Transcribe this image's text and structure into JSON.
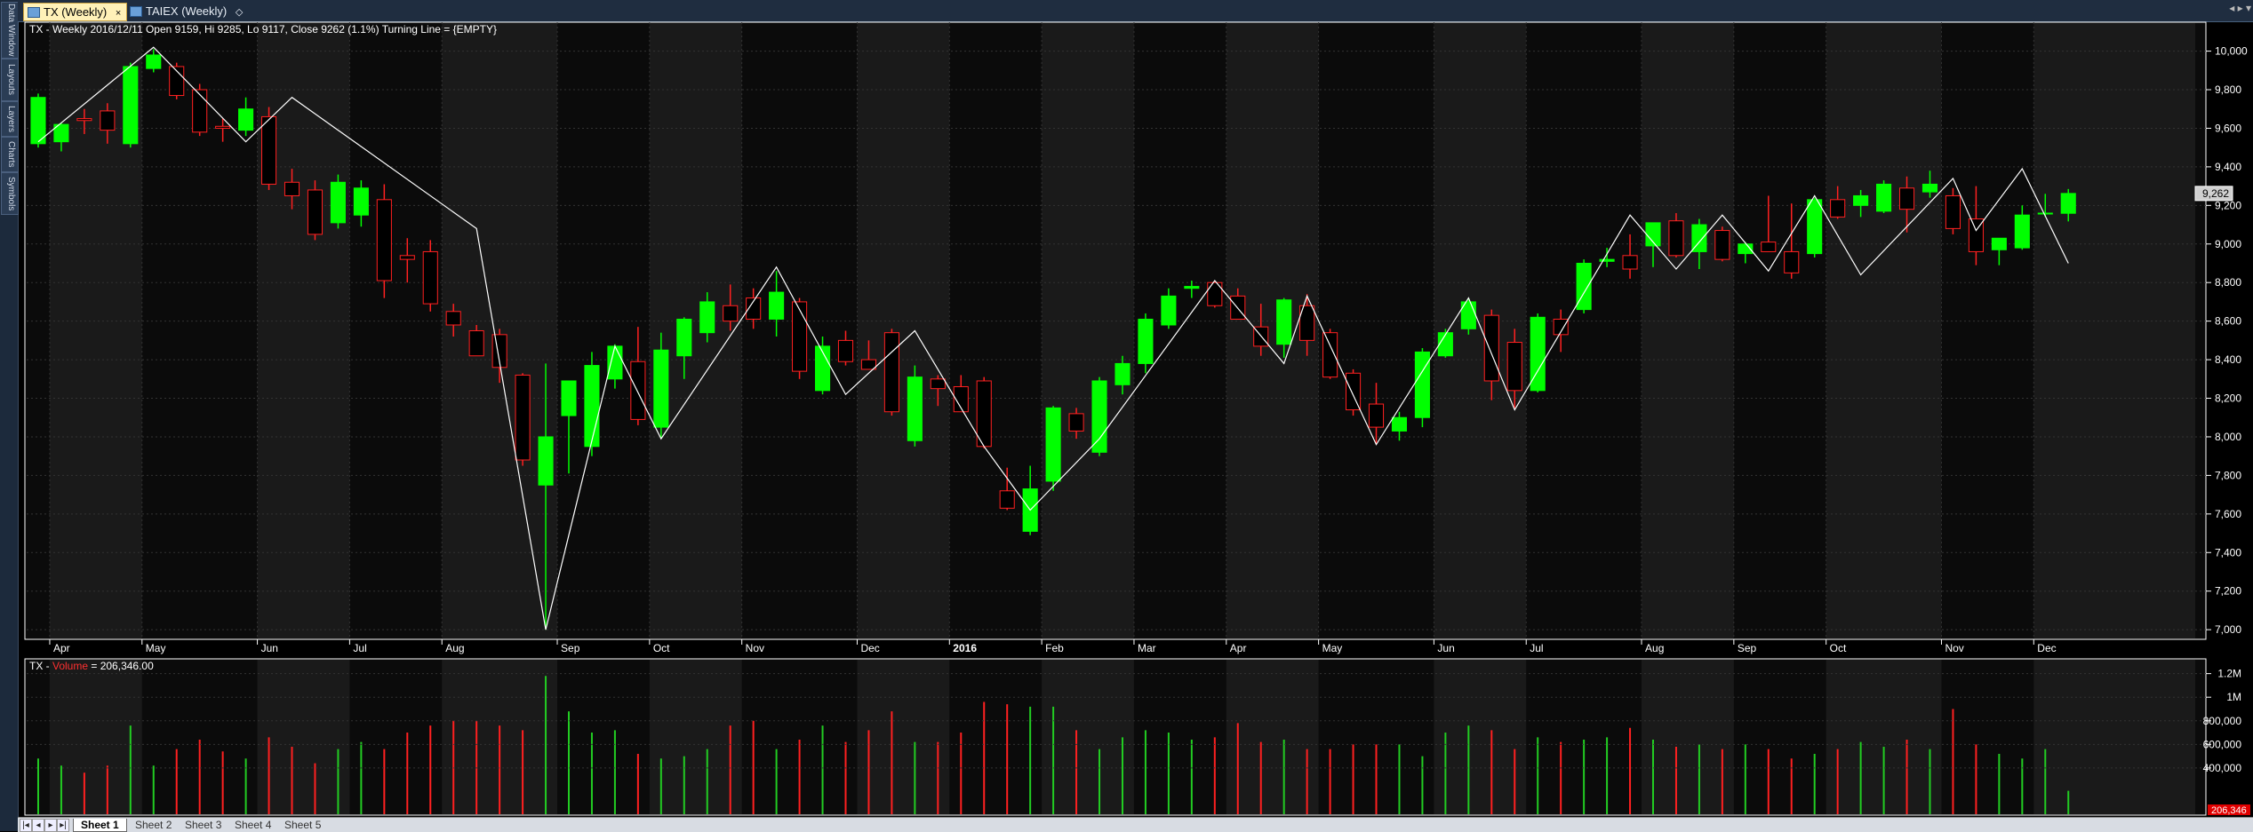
{
  "tabs": [
    {
      "label": "TX (Weekly)",
      "close": "×",
      "active": true
    },
    {
      "label": "TAIEX (Weekly)",
      "close": "◇",
      "active": false
    }
  ],
  "side_tabs": [
    "Data Window",
    "Layouts",
    "Layers",
    "Charts",
    "Symbols"
  ],
  "window_controls": "◂ ▸ ▾",
  "sheets": [
    "Sheet 1",
    "Sheet 2",
    "Sheet 3",
    "Sheet 4",
    "Sheet 5"
  ],
  "sheet_nav": [
    "|◂",
    "◂",
    "▸",
    "▸|"
  ],
  "price_title": "TX - Weekly 2016/12/11 Open 9159, Hi 9285, Lo 9117, Close 9262 (1.1%) Turning Line = {EMPTY}",
  "volume_title_prefix": "TX - ",
  "volume_title_name": "Volume",
  "volume_title_value": " = 206,346.00",
  "last_price_label": "9,262",
  "last_volume_label": "206,346",
  "colors": {
    "up": "#00ff00",
    "down_body": "#000000",
    "down_border": "#ff2020",
    "volume_up": "#22cc22",
    "volume_down": "#ff2020",
    "line": "#ffffff",
    "bg": "#0b0b0b",
    "band": "#1a1a1a",
    "axis_text": "#ffffff"
  },
  "chart_data": {
    "type": "candlestick",
    "y_axis": {
      "min": 6950,
      "max": 10150,
      "ticks": [
        7000,
        7200,
        7400,
        7600,
        7800,
        8000,
        8200,
        8400,
        8600,
        8800,
        9000,
        9200,
        9400,
        9600,
        9800,
        10000
      ],
      "tick_labels": [
        "7,000",
        "7,200",
        "7,400",
        "7,600",
        "7,800",
        "8,000",
        "8,200",
        "8,400",
        "8,600",
        "8,800",
        "9,000",
        "9,200",
        "9,400",
        "9,600",
        "9,800",
        "10,000"
      ]
    },
    "x_axis_labels": [
      "Apr",
      "May",
      "Jun",
      "Jul",
      "Aug",
      "Sep",
      "Oct",
      "Nov",
      "Dec",
      "2016",
      "Feb",
      "Mar",
      "Apr",
      "May",
      "Jun",
      "Jul",
      "Aug",
      "Sep",
      "Oct",
      "Nov",
      "Dec"
    ],
    "x_axis_label_weeks": [
      1,
      5,
      10,
      14,
      18,
      23,
      27,
      31,
      36,
      40,
      44,
      48,
      52,
      56,
      61,
      65,
      70,
      74,
      78,
      83,
      87
    ],
    "candles": [
      {
        "o": 9520,
        "h": 9780,
        "l": 9500,
        "c": 9760
      },
      {
        "o": 9530,
        "h": 9630,
        "l": 9480,
        "c": 9620
      },
      {
        "o": 9650,
        "h": 9700,
        "l": 9570,
        "c": 9640
      },
      {
        "o": 9690,
        "h": 9730,
        "l": 9520,
        "c": 9590
      },
      {
        "o": 9520,
        "h": 9940,
        "l": 9500,
        "c": 9920
      },
      {
        "o": 9910,
        "h": 10010,
        "l": 9890,
        "c": 9980
      },
      {
        "o": 9920,
        "h": 9940,
        "l": 9750,
        "c": 9770
      },
      {
        "o": 9800,
        "h": 9830,
        "l": 9560,
        "c": 9580
      },
      {
        "o": 9610,
        "h": 9650,
        "l": 9530,
        "c": 9600
      },
      {
        "o": 9590,
        "h": 9760,
        "l": 9560,
        "c": 9700
      },
      {
        "o": 9660,
        "h": 9710,
        "l": 9280,
        "c": 9310
      },
      {
        "o": 9320,
        "h": 9390,
        "l": 9180,
        "c": 9250
      },
      {
        "o": 9280,
        "h": 9330,
        "l": 9020,
        "c": 9050
      },
      {
        "o": 9110,
        "h": 9360,
        "l": 9080,
        "c": 9320
      },
      {
        "o": 9150,
        "h": 9330,
        "l": 9090,
        "c": 9290
      },
      {
        "o": 9230,
        "h": 9310,
        "l": 8720,
        "c": 8810
      },
      {
        "o": 8940,
        "h": 9030,
        "l": 8800,
        "c": 8920
      },
      {
        "o": 8960,
        "h": 9020,
        "l": 8650,
        "c": 8690
      },
      {
        "o": 8650,
        "h": 8690,
        "l": 8520,
        "c": 8580
      },
      {
        "o": 8550,
        "h": 8580,
        "l": 8430,
        "c": 8420
      },
      {
        "o": 8530,
        "h": 8560,
        "l": 8280,
        "c": 8360
      },
      {
        "o": 8320,
        "h": 8330,
        "l": 7850,
        "c": 7880
      },
      {
        "o": 7750,
        "h": 8380,
        "l": 7000,
        "c": 8000
      },
      {
        "o": 8110,
        "h": 8280,
        "l": 7810,
        "c": 8290
      },
      {
        "o": 7950,
        "h": 8440,
        "l": 7900,
        "c": 8370
      },
      {
        "o": 8300,
        "h": 8480,
        "l": 8250,
        "c": 8470
      },
      {
        "o": 8390,
        "h": 8570,
        "l": 8060,
        "c": 8090
      },
      {
        "o": 8050,
        "h": 8540,
        "l": 7990,
        "c": 8450
      },
      {
        "o": 8420,
        "h": 8620,
        "l": 8300,
        "c": 8610
      },
      {
        "o": 8540,
        "h": 8750,
        "l": 8490,
        "c": 8700
      },
      {
        "o": 8680,
        "h": 8790,
        "l": 8550,
        "c": 8600
      },
      {
        "o": 8720,
        "h": 8770,
        "l": 8560,
        "c": 8610
      },
      {
        "o": 8610,
        "h": 8860,
        "l": 8520,
        "c": 8750
      },
      {
        "o": 8700,
        "h": 8720,
        "l": 8300,
        "c": 8340
      },
      {
        "o": 8240,
        "h": 8520,
        "l": 8220,
        "c": 8470
      },
      {
        "o": 8500,
        "h": 8550,
        "l": 8370,
        "c": 8390
      },
      {
        "o": 8400,
        "h": 8500,
        "l": 8360,
        "c": 8350
      },
      {
        "o": 8540,
        "h": 8560,
        "l": 8110,
        "c": 8130
      },
      {
        "o": 7980,
        "h": 8370,
        "l": 7950,
        "c": 8310
      },
      {
        "o": 8300,
        "h": 8320,
        "l": 8160,
        "c": 8250
      },
      {
        "o": 8260,
        "h": 8320,
        "l": 8130,
        "c": 8130
      },
      {
        "o": 8290,
        "h": 8310,
        "l": 7940,
        "c": 7950
      },
      {
        "o": 7720,
        "h": 7840,
        "l": 7620,
        "c": 7630
      },
      {
        "o": 7510,
        "h": 7850,
        "l": 7490,
        "c": 7730
      },
      {
        "o": 7770,
        "h": 8160,
        "l": 7720,
        "c": 8150
      },
      {
        "o": 8120,
        "h": 8150,
        "l": 7990,
        "c": 8030
      },
      {
        "o": 7920,
        "h": 8310,
        "l": 7900,
        "c": 8290
      },
      {
        "o": 8270,
        "h": 8420,
        "l": 8220,
        "c": 8380
      },
      {
        "o": 8380,
        "h": 8640,
        "l": 8330,
        "c": 8610
      },
      {
        "o": 8580,
        "h": 8770,
        "l": 8560,
        "c": 8730
      },
      {
        "o": 8770,
        "h": 8810,
        "l": 8720,
        "c": 8780
      },
      {
        "o": 8800,
        "h": 8810,
        "l": 8670,
        "c": 8680
      },
      {
        "o": 8730,
        "h": 8770,
        "l": 8630,
        "c": 8610
      },
      {
        "o": 8570,
        "h": 8690,
        "l": 8420,
        "c": 8470
      },
      {
        "o": 8480,
        "h": 8720,
        "l": 8410,
        "c": 8710
      },
      {
        "o": 8680,
        "h": 8740,
        "l": 8420,
        "c": 8500
      },
      {
        "o": 8540,
        "h": 8560,
        "l": 8300,
        "c": 8310
      },
      {
        "o": 8330,
        "h": 8350,
        "l": 8110,
        "c": 8140
      },
      {
        "o": 8170,
        "h": 8280,
        "l": 7960,
        "c": 8050
      },
      {
        "o": 8030,
        "h": 8130,
        "l": 7980,
        "c": 8100
      },
      {
        "o": 8100,
        "h": 8460,
        "l": 8050,
        "c": 8440
      },
      {
        "o": 8420,
        "h": 8560,
        "l": 8410,
        "c": 8540
      },
      {
        "o": 8560,
        "h": 8720,
        "l": 8530,
        "c": 8700
      },
      {
        "o": 8630,
        "h": 8660,
        "l": 8190,
        "c": 8290
      },
      {
        "o": 8490,
        "h": 8560,
        "l": 8150,
        "c": 8240
      },
      {
        "o": 8240,
        "h": 8640,
        "l": 8230,
        "c": 8620
      },
      {
        "o": 8610,
        "h": 8660,
        "l": 8440,
        "c": 8530
      },
      {
        "o": 8660,
        "h": 8920,
        "l": 8640,
        "c": 8900
      },
      {
        "o": 8910,
        "h": 8980,
        "l": 8880,
        "c": 8920
      },
      {
        "o": 8940,
        "h": 9050,
        "l": 8820,
        "c": 8870
      },
      {
        "o": 8990,
        "h": 9110,
        "l": 8880,
        "c": 9110
      },
      {
        "o": 9120,
        "h": 9160,
        "l": 8930,
        "c": 8940
      },
      {
        "o": 8960,
        "h": 9130,
        "l": 8870,
        "c": 9100
      },
      {
        "o": 9070,
        "h": 9090,
        "l": 8910,
        "c": 8920
      },
      {
        "o": 8950,
        "h": 9010,
        "l": 8900,
        "c": 9000
      },
      {
        "o": 9010,
        "h": 9250,
        "l": 8960,
        "c": 8960
      },
      {
        "o": 8960,
        "h": 9210,
        "l": 8820,
        "c": 8850
      },
      {
        "o": 8950,
        "h": 9240,
        "l": 8930,
        "c": 9230
      },
      {
        "o": 9230,
        "h": 9300,
        "l": 9130,
        "c": 9140
      },
      {
        "o": 9200,
        "h": 9280,
        "l": 9140,
        "c": 9250
      },
      {
        "o": 9170,
        "h": 9330,
        "l": 9160,
        "c": 9310
      },
      {
        "o": 9290,
        "h": 9350,
        "l": 9060,
        "c": 9180
      },
      {
        "o": 9270,
        "h": 9380,
        "l": 9240,
        "c": 9310
      },
      {
        "o": 9250,
        "h": 9290,
        "l": 9050,
        "c": 9080
      },
      {
        "o": 9130,
        "h": 9300,
        "l": 8890,
        "c": 8960
      },
      {
        "o": 8970,
        "h": 9030,
        "l": 8890,
        "c": 9030
      },
      {
        "o": 8980,
        "h": 9200,
        "l": 8970,
        "c": 9150
      },
      {
        "o": 9160,
        "h": 9260,
        "l": 9140,
        "c": 9160
      },
      {
        "o": 9159,
        "h": 9285,
        "l": 9117,
        "c": 9262
      }
    ],
    "turning_line": [
      [
        0,
        9530
      ],
      [
        5,
        10020
      ],
      [
        9,
        9530
      ],
      [
        11,
        9760
      ],
      [
        19,
        9080
      ],
      [
        22,
        7000
      ],
      [
        25,
        8470
      ],
      [
        27,
        7990
      ],
      [
        32,
        8880
      ],
      [
        35,
        8220
      ],
      [
        38,
        8550
      ],
      [
        41,
        7950
      ],
      [
        43,
        7620
      ],
      [
        46,
        7990
      ],
      [
        51,
        8810
      ],
      [
        54,
        8380
      ],
      [
        55,
        8730
      ],
      [
        58,
        7960
      ],
      [
        62,
        8720
      ],
      [
        64,
        8140
      ],
      [
        69,
        9150
      ],
      [
        71,
        8870
      ],
      [
        73,
        9150
      ],
      [
        75,
        8860
      ],
      [
        77,
        9250
      ],
      [
        79,
        8840
      ],
      [
        83,
        9340
      ],
      [
        84,
        9070
      ],
      [
        86,
        9390
      ],
      [
        88,
        8900
      ]
    ],
    "volume_axis": {
      "max": 1250000,
      "ticks": [
        400000,
        600000,
        800000,
        1000000,
        1200000
      ],
      "tick_labels": [
        "400,000",
        "600,000",
        "800,000",
        "1M",
        "1.2M"
      ]
    },
    "volumes": [
      480000,
      420000,
      360000,
      420000,
      760000,
      420000,
      560000,
      640000,
      540000,
      480000,
      660000,
      580000,
      440000,
      560000,
      620000,
      560000,
      700000,
      760000,
      800000,
      800000,
      760000,
      720000,
      1180000,
      880000,
      700000,
      720000,
      520000,
      480000,
      500000,
      560000,
      760000,
      800000,
      560000,
      640000,
      760000,
      620000,
      720000,
      880000,
      620000,
      620000,
      700000,
      960000,
      940000,
      920000,
      920000,
      720000,
      560000,
      660000,
      720000,
      700000,
      640000,
      660000,
      780000,
      620000,
      640000,
      560000,
      560000,
      600000,
      600000,
      600000,
      500000,
      700000,
      760000,
      720000,
      560000,
      660000,
      620000,
      640000,
      660000,
      740000,
      640000,
      580000,
      600000,
      560000,
      600000,
      560000,
      480000,
      520000,
      560000,
      620000,
      580000,
      640000,
      560000,
      900000,
      600000,
      520000,
      480000,
      560000,
      206346
    ]
  }
}
